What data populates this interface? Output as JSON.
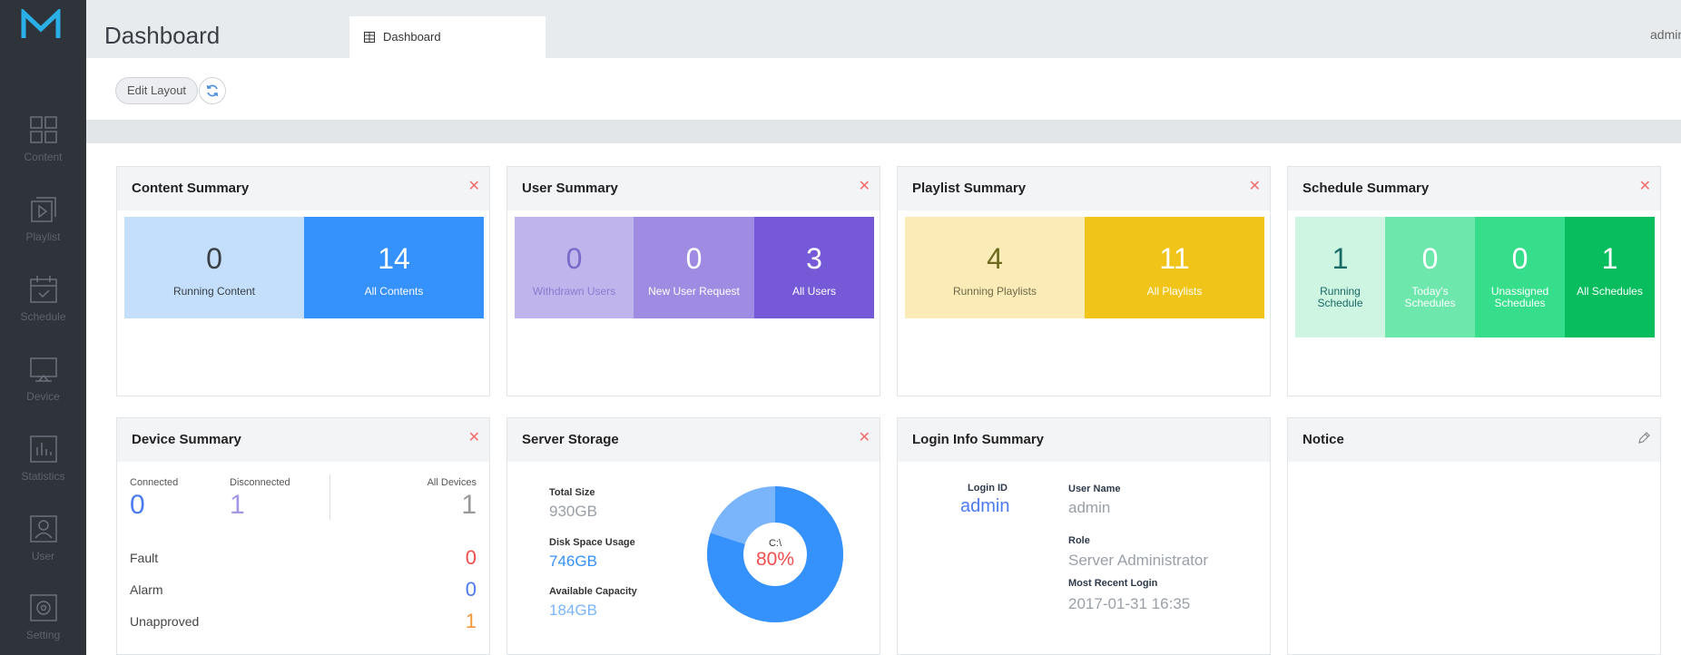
{
  "sidebar": {
    "items": [
      {
        "label": "Content"
      },
      {
        "label": "Playlist"
      },
      {
        "label": "Schedule"
      },
      {
        "label": "Device"
      },
      {
        "label": "Statistics"
      },
      {
        "label": "User"
      },
      {
        "label": "Setting"
      }
    ]
  },
  "header": {
    "title": "Dashboard",
    "tab_label": "Dashboard",
    "user": "admin"
  },
  "toolbar": {
    "edit_label": "Edit Layout"
  },
  "widgets": {
    "content": {
      "title": "Content Summary",
      "tiles": [
        {
          "value": "0",
          "label": "Running Content"
        },
        {
          "value": "14",
          "label": "All Contents"
        }
      ]
    },
    "user": {
      "title": "User Summary",
      "tiles": [
        {
          "value": "0",
          "label": "Withdrawn Users"
        },
        {
          "value": "0",
          "label": "New User Request"
        },
        {
          "value": "3",
          "label": "All Users"
        }
      ]
    },
    "playlist": {
      "title": "Playlist Summary",
      "tiles": [
        {
          "value": "4",
          "label": "Running Playlists"
        },
        {
          "value": "11",
          "label": "All Playlists"
        }
      ]
    },
    "schedule": {
      "title": "Schedule Summary",
      "tiles": [
        {
          "value": "1",
          "label": "Running Schedule"
        },
        {
          "value": "0",
          "label": "Today's Schedules"
        },
        {
          "value": "0",
          "label": "Unassigned Schedules"
        },
        {
          "value": "1",
          "label": "All Schedules"
        }
      ]
    },
    "device": {
      "title": "Device Summary",
      "connected_label": "Connected",
      "connected_value": "0",
      "disconnected_label": "Disconnected",
      "disconnected_value": "1",
      "all_label": "All Devices",
      "all_value": "1",
      "rows": [
        {
          "label": "Fault",
          "value": "0"
        },
        {
          "label": "Alarm",
          "value": "0"
        },
        {
          "label": "Unapproved",
          "value": "1"
        }
      ]
    },
    "storage": {
      "title": "Server Storage",
      "total_label": "Total Size",
      "total_value": "930GB",
      "usage_label": "Disk Space Usage",
      "usage_value": "746GB",
      "available_label": "Available Capacity",
      "available_value": "184GB",
      "drive": "C:\\",
      "percent_label": "80%",
      "used_fraction": 0.8
    },
    "login": {
      "title": "Login Info Summary",
      "login_id_label": "Login ID",
      "login_id": "admin",
      "user_name_label": "User Name",
      "user_name": "admin",
      "role_label": "Role",
      "role": "Server Administrator",
      "recent_label": "Most Recent Login",
      "recent": "2017-01-31 16:35"
    },
    "notice": {
      "title": "Notice"
    }
  },
  "colors": {
    "sidebar_bg": "#2f343b",
    "content_light": "#c3dffb",
    "content_dark": "#3591fb",
    "user_1": "#bfb5ec",
    "user_2": "#9f8ce2",
    "user_3": "#7659d7",
    "playlist_light": "#fbebb6",
    "playlist_dark": "#f0c418",
    "schedule_1": "#cdf5e1",
    "schedule_2": "#6ee7ac",
    "schedule_3": "#36dd8a",
    "schedule_4": "#07bd5d",
    "alert_red": "#f04d4d",
    "info_blue": "#4b7bf0",
    "warn_orange": "#f6983a",
    "donut_used": "#3591fb",
    "donut_free": "#7ab5fb"
  }
}
